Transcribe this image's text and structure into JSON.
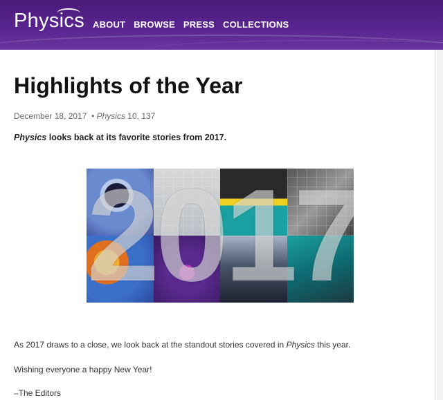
{
  "site": {
    "logo_text": "Physics",
    "nav": [
      "ABOUT",
      "BROWSE",
      "PRESS",
      "COLLECTIONS"
    ]
  },
  "article": {
    "title": "Highlights of the Year",
    "date": "December 18, 2017",
    "journal": "Physics",
    "citation": "10, 137",
    "summary_journal": "Physics",
    "summary_text": " looks back at its favorite stories from 2017.",
    "banner_text": [
      "2",
      "0",
      "1",
      "7"
    ],
    "body": [
      {
        "before": "As 2017 draws to a close, we look back at the standout stories covered in ",
        "italic": "Physics",
        "after": " this year."
      },
      {
        "before": "Wishing everyone a happy New Year!",
        "italic": "",
        "after": ""
      },
      {
        "before": "–The Editors",
        "italic": "",
        "after": ""
      }
    ]
  },
  "colors": {
    "header_purple": "#5a2590",
    "link_white": "#ffffff"
  }
}
